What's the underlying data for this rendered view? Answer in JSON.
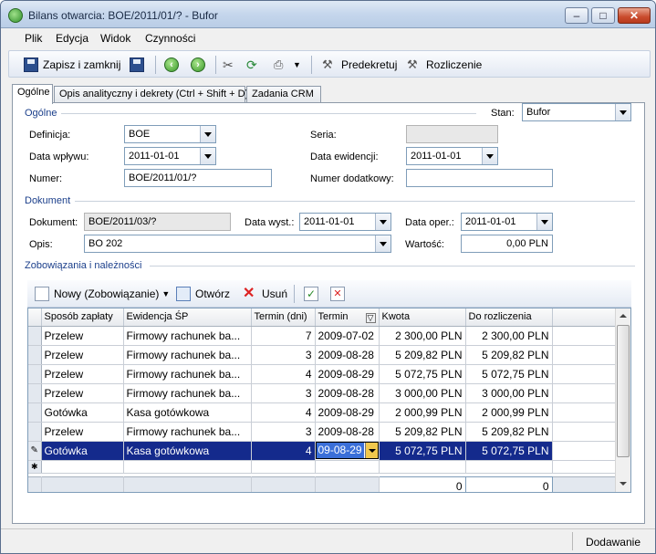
{
  "window": {
    "title": "Bilans otwarcia: BOE/2011/01/? - Bufor"
  },
  "menu": [
    {
      "label": "Plik"
    },
    {
      "label": "Edycja"
    },
    {
      "label": "Widok"
    },
    {
      "label": "Czynności"
    }
  ],
  "toolbar": {
    "save_close": "Zapisz i zamknij",
    "predekretuj": "Predekretuj",
    "rozliczenie": "Rozliczenie"
  },
  "tabs": [
    {
      "label": "Ogólne"
    },
    {
      "label": "Opis analityczny i dekrety (Ctrl + Shift + D)"
    },
    {
      "label": "Zadania CRM"
    }
  ],
  "general": {
    "section_title": "Ogólne",
    "stan_label": "Stan:",
    "stan_value": "Bufor",
    "definicja_label": "Definicja:",
    "definicja_value": "BOE",
    "seria_label": "Seria:",
    "seria_value": "",
    "data_wplywu_label": "Data wpływu:",
    "data_wplywu_value": "2011-01-01",
    "data_ewidencji_label": "Data ewidencji:",
    "data_ewidencji_value": "2011-01-01",
    "numer_label": "Numer:",
    "numer_value": "BOE/2011/01/?",
    "numer_dodatkowy_label": "Numer dodatkowy:",
    "numer_dodatkowy_value": ""
  },
  "document": {
    "section_title": "Dokument",
    "dokument_label": "Dokument:",
    "dokument_value": "BOE/2011/03/?",
    "data_wyst_label": "Data wyst.:",
    "data_wyst_value": "2011-01-01",
    "data_oper_label": "Data oper.:",
    "data_oper_value": "2011-01-01",
    "opis_label": "Opis:",
    "opis_value": "BO 202",
    "wartosc_label": "Wartość:",
    "wartosc_value": "0,00 PLN"
  },
  "obligations": {
    "section_title": "Zobowiązania i należności",
    "new_button": "Nowy (Zobowiązanie)",
    "open_button": "Otwórz",
    "delete_button": "Usuń",
    "columns": [
      "Sposób zapłaty",
      "Ewidencja ŚP",
      "Termin (dni)",
      "Termin",
      "Kwota",
      "Do rozliczenia"
    ],
    "rows": [
      {
        "sposob": "Przelew",
        "ewidencja": "Firmowy rachunek ba...",
        "dni": "7",
        "termin": "2009-07-02",
        "kwota": "2 300,00 PLN",
        "do_rozliczenia": "2 300,00 PLN"
      },
      {
        "sposob": "Przelew",
        "ewidencja": "Firmowy rachunek ba...",
        "dni": "3",
        "termin": "2009-08-28",
        "kwota": "5 209,82 PLN",
        "do_rozliczenia": "5 209,82 PLN"
      },
      {
        "sposob": "Przelew",
        "ewidencja": "Firmowy rachunek ba...",
        "dni": "4",
        "termin": "2009-08-29",
        "kwota": "5 072,75 PLN",
        "do_rozliczenia": "5 072,75 PLN"
      },
      {
        "sposob": "Przelew",
        "ewidencja": "Firmowy rachunek ba...",
        "dni": "3",
        "termin": "2009-08-28",
        "kwota": "3 000,00 PLN",
        "do_rozliczenia": "3 000,00 PLN"
      },
      {
        "sposob": "Gotówka",
        "ewidencja": "Kasa gotówkowa",
        "dni": "4",
        "termin": "2009-08-29",
        "kwota": "2 000,99 PLN",
        "do_rozliczenia": "2 000,99 PLN"
      },
      {
        "sposob": "Przelew",
        "ewidencja": "Firmowy rachunek ba...",
        "dni": "3",
        "termin": "2009-08-28",
        "kwota": "5 209,82 PLN",
        "do_rozliczenia": "5 209,82 PLN"
      },
      {
        "sposob": "Gotówka",
        "ewidencja": "Kasa gotówkowa",
        "dni": "4",
        "termin": "09-08-29",
        "kwota": "5 072,75 PLN",
        "do_rozliczenia": "5 072,75 PLN"
      }
    ],
    "totals": {
      "kwota": "0",
      "do_rozliczenia": "0"
    }
  },
  "status": {
    "text": "Dodawanie"
  }
}
